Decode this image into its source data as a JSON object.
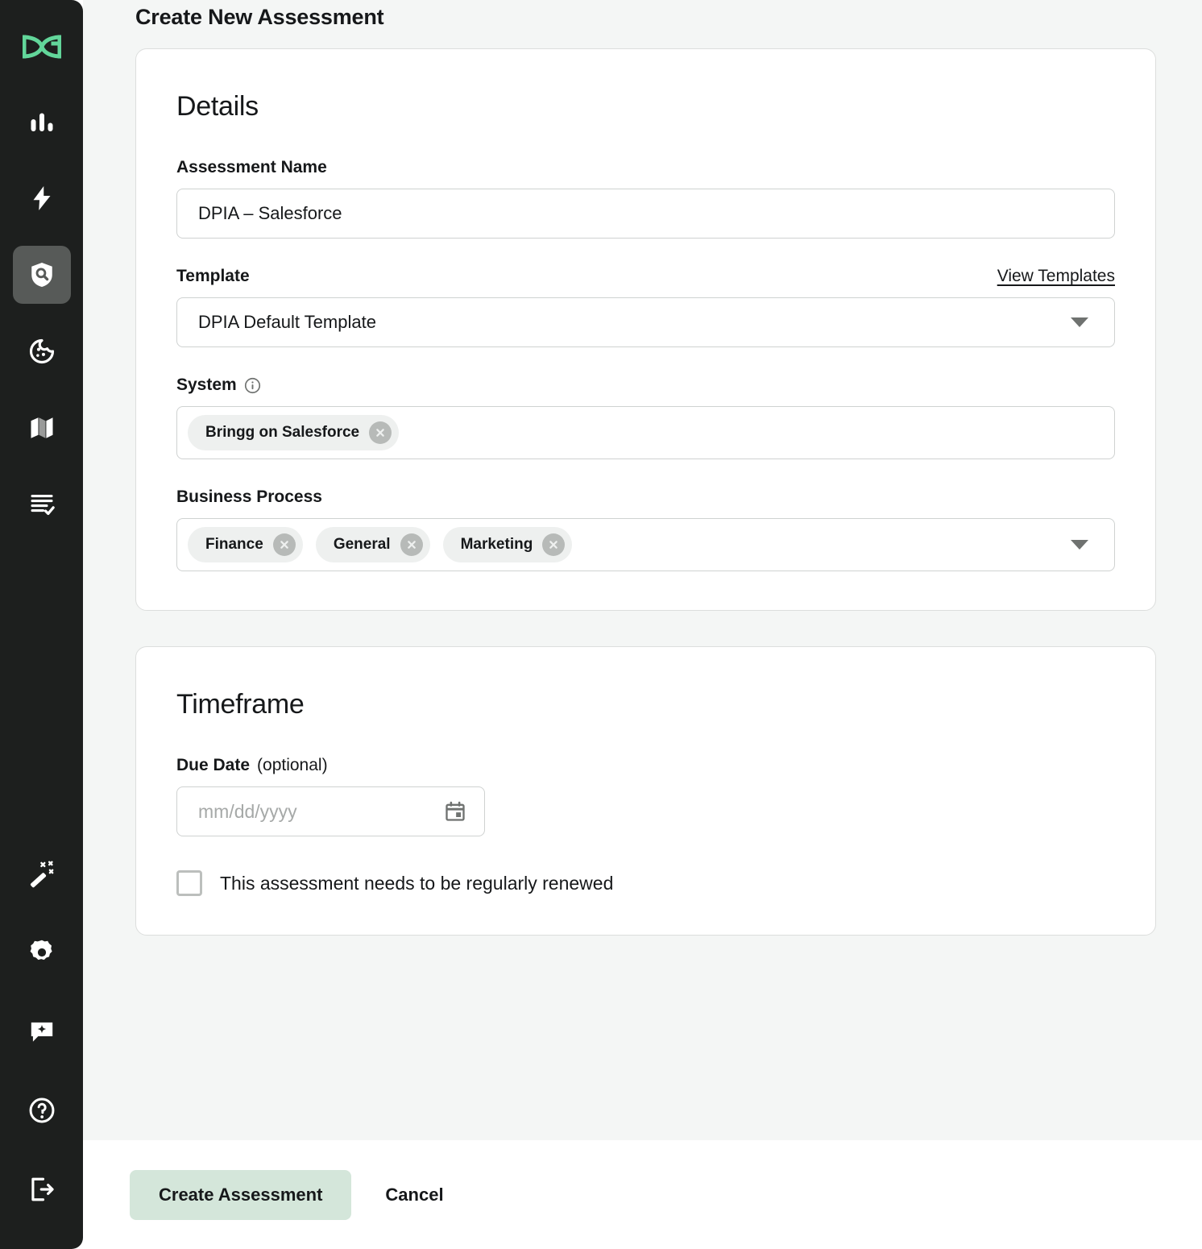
{
  "sidebar": {
    "logo": {
      "name": "brand-logo",
      "color": "#62d69a"
    },
    "top_items": [
      {
        "icon": "bar-chart-icon",
        "active": false
      },
      {
        "icon": "lightning-bolt-icon",
        "active": false
      },
      {
        "icon": "shield-search-icon",
        "active": true
      },
      {
        "icon": "cookie-icon",
        "active": false
      },
      {
        "icon": "map-icon",
        "active": false
      },
      {
        "icon": "document-check-icon",
        "active": false
      }
    ],
    "bottom_items": [
      {
        "icon": "magic-wand-icon",
        "active": false
      },
      {
        "icon": "gear-icon",
        "active": false
      },
      {
        "icon": "chat-sparkle-icon",
        "active": false
      },
      {
        "icon": "help-circle-icon",
        "active": false
      },
      {
        "icon": "logout-icon",
        "active": false
      }
    ]
  },
  "page": {
    "title": "Create New Assessment"
  },
  "details": {
    "heading": "Details",
    "assessment_name": {
      "label": "Assessment Name",
      "value": "DPIA – Salesforce"
    },
    "template": {
      "label": "Template",
      "link_label": "View Templates",
      "value": "DPIA Default Template"
    },
    "system": {
      "label": "System",
      "info_icon": "info-circle-icon",
      "chips": [
        "Bringg on Salesforce"
      ]
    },
    "business_process": {
      "label": "Business Process",
      "chips": [
        "Finance",
        "General",
        "Marketing"
      ]
    }
  },
  "timeframe": {
    "heading": "Timeframe",
    "due_date": {
      "label": "Due Date",
      "optional_suffix": " (optional)",
      "placeholder": "mm/dd/yyyy",
      "value": "",
      "icon": "calendar-icon"
    },
    "renew_checkbox": {
      "label": "This assessment needs to be regularly renewed",
      "checked": false
    }
  },
  "footer": {
    "primary_label": "Create Assessment",
    "cancel_label": "Cancel",
    "primary_color": "#d4e6da"
  }
}
